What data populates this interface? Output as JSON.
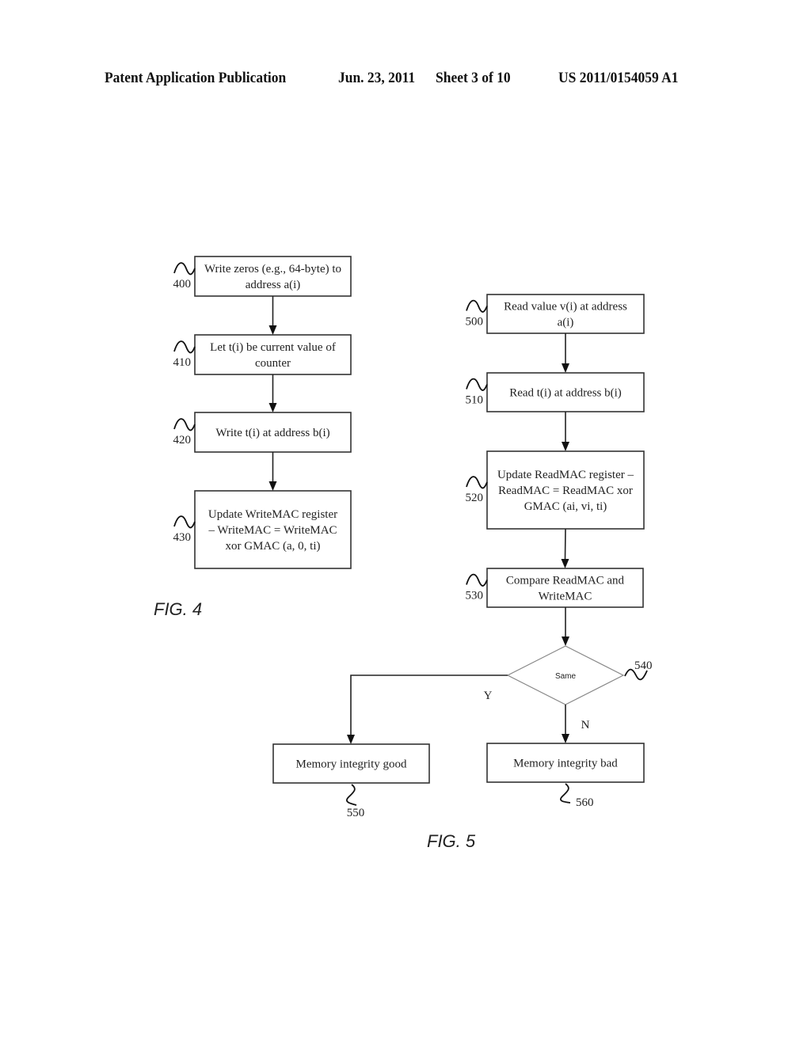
{
  "header": {
    "publication": "Patent Application Publication",
    "date": "Jun. 23, 2011",
    "sheet": "Sheet 3 of 10",
    "number": "US 2011/0154059 A1"
  },
  "fig4": {
    "label": "FIG. 4",
    "steps": [
      {
        "ref": "400",
        "lines": [
          "Write zeros (e.g., 64-byte) to",
          "address a(i)"
        ]
      },
      {
        "ref": "410",
        "lines": [
          "Let t(i) be current value of",
          "counter"
        ]
      },
      {
        "ref": "420",
        "lines": [
          "Write t(i) at address b(i)"
        ]
      },
      {
        "ref": "430",
        "lines": [
          "Update WriteMAC register",
          "– WriteMAC = WriteMAC",
          "xor GMAC (a, 0, ti)"
        ]
      }
    ]
  },
  "fig5": {
    "label": "FIG. 5",
    "steps": [
      {
        "ref": "500",
        "lines": [
          "Read value v(i) at address",
          "a(i)"
        ]
      },
      {
        "ref": "510",
        "lines": [
          "Read t(i) at address b(i)"
        ]
      },
      {
        "ref": "520",
        "lines": [
          "Update ReadMAC register –",
          "ReadMAC = ReadMAC xor",
          "GMAC (ai, vi, ti)"
        ]
      },
      {
        "ref": "530",
        "lines": [
          "Compare ReadMAC and",
          "WriteMAC"
        ]
      }
    ],
    "decision": {
      "ref": "540",
      "label": "Same",
      "yes_label": "Y",
      "no_label": "N"
    },
    "outcomes": [
      {
        "ref": "550",
        "lines": [
          "Memory integrity good"
        ]
      },
      {
        "ref": "560",
        "lines": [
          "Memory integrity bad"
        ]
      }
    ]
  }
}
